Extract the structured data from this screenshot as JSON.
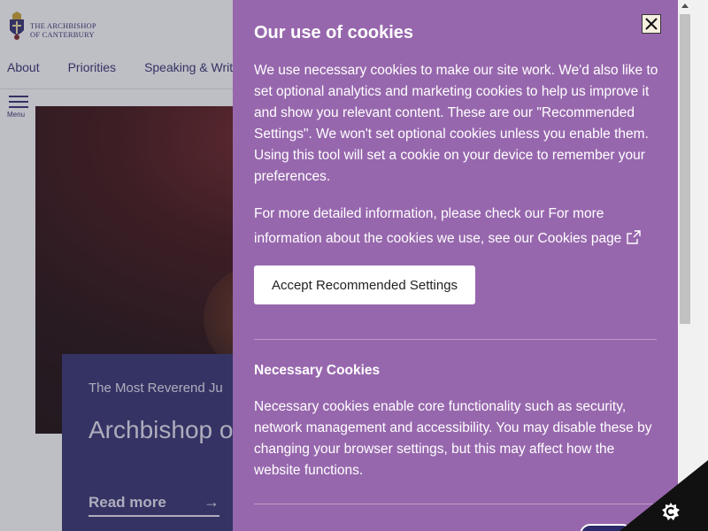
{
  "site": {
    "logo": {
      "line1": "THE ARCHBISHOP",
      "line2": "OF CANTERBURY"
    },
    "nav": [
      {
        "label": "About"
      },
      {
        "label": "Priorities"
      },
      {
        "label": "Speaking & Writ"
      }
    ],
    "menu_label": "Menu",
    "hero": {
      "subtitle": "The Most Reverend Ju",
      "title": "Archbishop o Canterbury",
      "read_more": "Read more",
      "arrow": "→"
    }
  },
  "cookie_panel": {
    "title": "Our use of cookies",
    "intro": "We use necessary cookies to make our site work. We'd also like to set optional analytics and marketing cookies to help us improve it and show you relevant content. These are our \"Recommended Settings\". We won't set optional cookies unless you enable them. Using this tool will set a cookie on your device to remember your preferences.",
    "more_info_text": "For more detailed information, please check our For more information about the cookies we use, see our Cookies page",
    "accept_button": "Accept Recommended Settings",
    "necessary_heading": "Necessary Cookies",
    "necessary_text": "Necessary cookies enable core functionality such as security, network management and accessibility. You may disable these by changing your browser settings, but this may affect how the website functions."
  },
  "colors": {
    "panel_bg": "#9767ad",
    "site_accent": "#2b2a6b",
    "button_bg": "#ffffff"
  },
  "icons": [
    "crest-logo-icon",
    "hamburger-icon",
    "close-icon",
    "external-link-icon",
    "arrow-right-icon",
    "cookie-control-icon"
  ]
}
